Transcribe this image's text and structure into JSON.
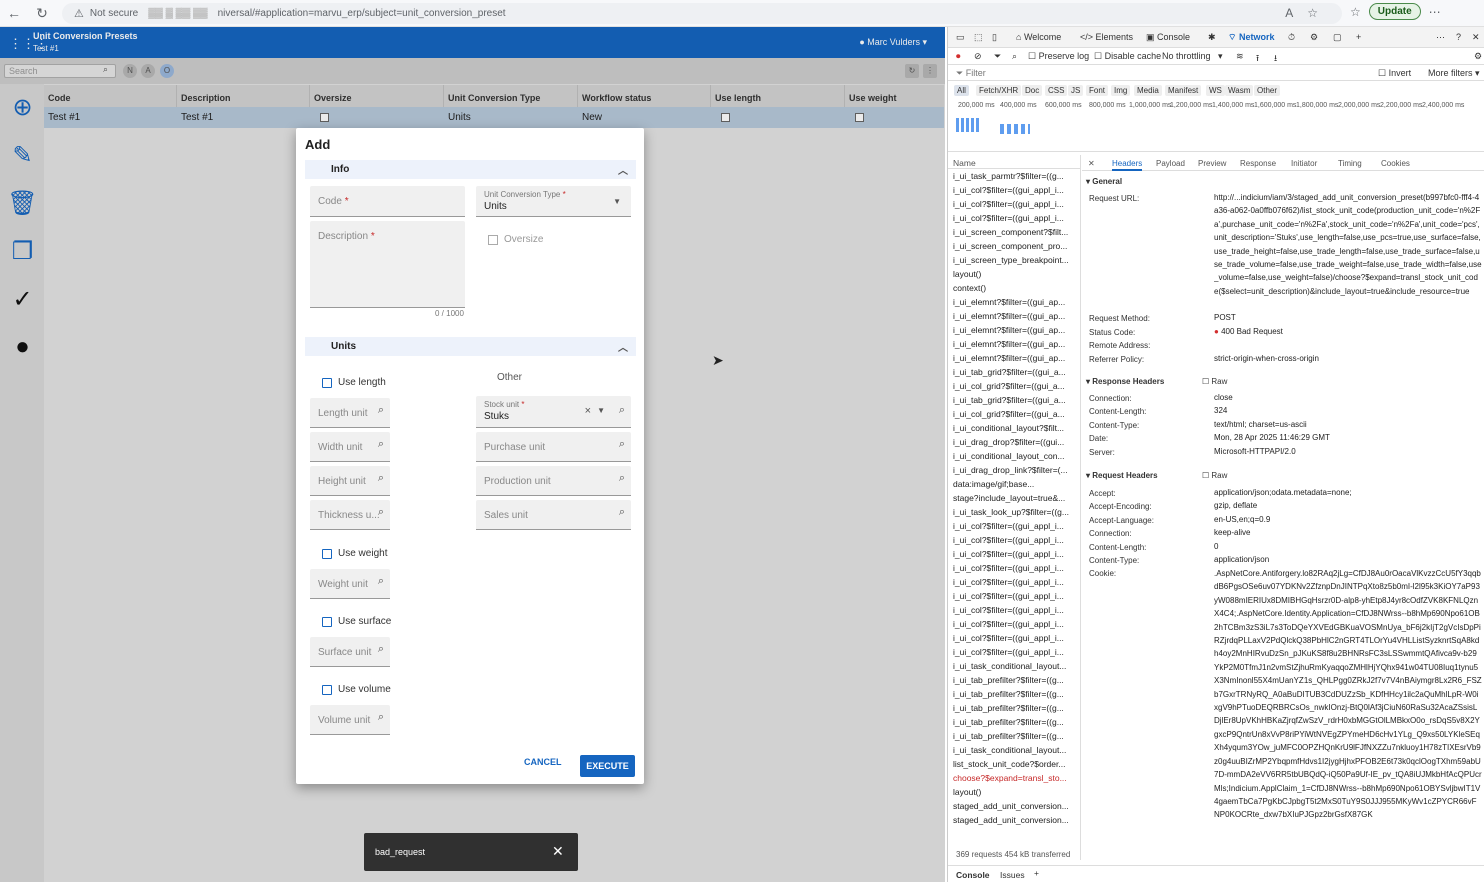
{
  "browser": {
    "security": "Not secure",
    "url": "niversal/#application=marvu_erp/subject=unit_conversion_preset",
    "update_label": "Update"
  },
  "app": {
    "title": "Unit Conversion Presets",
    "subtitle": "Test #1",
    "user": "Marc Vulders",
    "search_placeholder": "Search",
    "chips": [
      "N",
      "A",
      "O"
    ],
    "columns": [
      "Code",
      "Description",
      "Oversize",
      "Unit Conversion Type",
      "Workflow status",
      "Use length",
      "Use weight"
    ],
    "row": {
      "code": "Test #1",
      "description": "Test #1",
      "type": "Units",
      "status": "New"
    }
  },
  "dialog": {
    "title": "Add",
    "info_section": "Info",
    "code_label": "Code",
    "description_label": "Description",
    "type_label": "Unit Conversion Type",
    "type_value": "Units",
    "oversize_label": "Oversize",
    "counter": "0 / 1000",
    "units_section": "Units",
    "use_length": "Use length",
    "other_label": "Other",
    "length_unit": "Length unit",
    "width_unit": "Width unit",
    "height_unit": "Height unit",
    "thickness_unit": "Thickness u...",
    "stock_unit_label": "Stock unit",
    "stock_unit_value": "Stuks",
    "purchase_unit": "Purchase unit",
    "production_unit": "Production unit",
    "sales_unit": "Sales unit",
    "use_weight": "Use weight",
    "weight_unit": "Weight unit",
    "use_surface": "Use surface",
    "surface_unit": "Surface unit",
    "use_volume": "Use volume",
    "volume_unit": "Volume unit",
    "cancel": "CANCEL",
    "execute": "EXECUTE"
  },
  "toast": {
    "message": "bad_request"
  },
  "devtools": {
    "tabs": [
      "Welcome",
      "Elements",
      "Console",
      "Network"
    ],
    "preserve_log": "Preserve log",
    "disable_cache": "Disable cache",
    "throttling": "No throttling",
    "filter": "Filter",
    "invert": "Invert",
    "more_filters": "More filters",
    "types": [
      "All",
      "Fetch/XHR",
      "Doc",
      "CSS",
      "JS",
      "Font",
      "Img",
      "Media",
      "Manifest",
      "WS",
      "Wasm",
      "Other"
    ],
    "timeline_ticks": [
      "200,000 ms",
      "400,000 ms",
      "600,000 ms",
      "800,000 ms",
      "1,000,000 ms",
      "1,200,000 ms",
      "1,400,000 ms",
      "1,600,000 ms",
      "1,800,000 ms",
      "2,000,000 ms",
      "2,200,000 ms",
      "2,400,000 ms"
    ],
    "name_header": "Name",
    "requests": [
      "i_ui_task_parmtr?$filter=((g...",
      "i_ui_col?$filter=((gui_appl_i...",
      "i_ui_col?$filter=((gui_appl_i...",
      "i_ui_col?$filter=((gui_appl_i...",
      "i_ui_screen_component?$filt...",
      "i_ui_screen_component_pro...",
      "i_ui_screen_type_breakpoint...",
      "layout()",
      "context()",
      "i_ui_elemnt?$filter=((gui_ap...",
      "i_ui_elemnt?$filter=((gui_ap...",
      "i_ui_elemnt?$filter=((gui_ap...",
      "i_ui_elemnt?$filter=((gui_ap...",
      "i_ui_elemnt?$filter=((gui_ap...",
      "i_ui_tab_grid?$filter=((gui_a...",
      "i_ui_col_grid?$filter=((gui_a...",
      "i_ui_tab_grid?$filter=((gui_a...",
      "i_ui_col_grid?$filter=((gui_a...",
      "i_ui_conditional_layout?$filt...",
      "i_ui_drag_drop?$filter=((gui...",
      "i_ui_conditional_layout_con...",
      "i_ui_drag_drop_link?$filter=(...",
      "data:image/gif;base...",
      "stage?include_layout=true&...",
      "i_ui_task_look_up?$filter=((g...",
      "i_ui_col?$filter=((gui_appl_i...",
      "i_ui_col?$filter=((gui_appl_i...",
      "i_ui_col?$filter=((gui_appl_i...",
      "i_ui_col?$filter=((gui_appl_i...",
      "i_ui_col?$filter=((gui_appl_i...",
      "i_ui_col?$filter=((gui_appl_i...",
      "i_ui_col?$filter=((gui_appl_i...",
      "i_ui_col?$filter=((gui_appl_i...",
      "i_ui_col?$filter=((gui_appl_i...",
      "i_ui_col?$filter=((gui_appl_i...",
      "i_ui_task_conditional_layout...",
      "i_ui_tab_prefilter?$filter=((g...",
      "i_ui_tab_prefilter?$filter=((g...",
      "i_ui_tab_prefilter?$filter=((g...",
      "i_ui_tab_prefilter?$filter=((g...",
      "i_ui_tab_prefilter?$filter=((g...",
      "i_ui_task_conditional_layout...",
      "list_stock_unit_code?$order...",
      "choose?$expand=transl_sto...",
      "layout()",
      "staged_add_unit_conversion...",
      "staged_add_unit_conversion..."
    ],
    "summary": "369 requests   454 kB transferred",
    "detail_tabs": [
      "Headers",
      "Payload",
      "Preview",
      "Response",
      "Initiator",
      "Timing",
      "Cookies"
    ],
    "general": "General",
    "request_url_key": "Request URL:",
    "request_url": "http://...indicium/iam/3/staged_add_unit_conversion_preset(b997bfc0-fff4-4a36-a062-0a0ffb076f62)/list_stock_unit_code(production_unit_code='n%2Fa',purchase_unit_code='n%2Fa',stock_unit_code='n%2Fa',unit_code='pcs',unit_description='Stuks',use_length=false,use_pcs=true,use_surface=false,use_trade_height=false,use_trade_length=false,use_trade_surface=false,use_trade_volume=false,use_trade_weight=false,use_trade_width=false,use_volume=false,use_weight=false)/choose?$expand=transl_stock_unit_code($select=unit_description)&include_layout=true&include_resource=true",
    "method_key": "Request Method:",
    "method": "POST",
    "status_key": "Status Code:",
    "status": "400 Bad Request",
    "remote_key": "Remote Address:",
    "referrer_key": "Referrer Policy:",
    "referrer": "strict-origin-when-cross-origin",
    "response_headers": "Response Headers",
    "raw": "Raw",
    "resp": [
      [
        "Connection:",
        "close"
      ],
      [
        "Content-Length:",
        "324"
      ],
      [
        "Content-Type:",
        "text/html; charset=us-ascii"
      ],
      [
        "Date:",
        "Mon, 28 Apr 2025 11:46:29 GMT"
      ],
      [
        "Server:",
        "Microsoft-HTTPAPI/2.0"
      ]
    ],
    "request_headers": "Request Headers",
    "req": [
      [
        "Accept:",
        "application/json;odata.metadata=none;"
      ],
      [
        "Accept-Encoding:",
        "gzip, deflate"
      ],
      [
        "Accept-Language:",
        "en-US,en;q=0.9"
      ],
      [
        "Connection:",
        "keep-alive"
      ],
      [
        "Content-Length:",
        "0"
      ],
      [
        "Content-Type:",
        "application/json"
      ],
      [
        "Cookie:",
        ""
      ]
    ],
    "cookie": ".AspNetCore.Antiforgery.lo82RAq2jLg=CfDJ8Au0rOacaVlKvzzCcU5fY3qqbdB6PgsOSe6uv07YDKNv2ZfznpDnJINTPqXto8z5b0mI-l2l95k3KiOY7aP93yW088mIERIUx8DMIBHGqHsrzr0D-alp8-yhEtp8J4yr8cOdfZVK8KFNLQznX4C4;.AspNetCore.Identity.Application=CfDJ8NWrss--b8hMp690Npo61OB2hTCBm3zS3iL7s3ToDQeYXVEdGBKuaVOSMnUya_bF6j2kIjT2gVcIsDpPiRZjrdqPLLaxV2PdQlckQ38PbHlC2nGRT4TLOrYu4VHLListSyzknrtSqA8kdh4oy2MnHIRvuDzSn_pJKuKS8f8u2BHNRsFC3sLSSwmmtQAfivca9v-b29YkP2M0TfmJ1n2vmStZjhuRmKyaqqoZMHlHjYQhx941w04TU08Iuq1tynu5X3NmInonl55X4mUanYZ1s_QHLPgg0ZRkJ2f7v7V4nBAiymgr8Lx2R6_FSZb7GxrTRNyRQ_A0aBuDITUB3CdDUZzSb_KDfHHcy1ilc2aQuMhlLpR-W0ixgV9hPTuoDEQRBRCsOs_nwkIOnzj-BtQ0lAf3jCiuN60RaSu32AcaZSsisLDjlEr8UpVKhHBKaZjrqfZwSzV_rdrH0xbMGGtOlLMBkxO0o_rsDqS5v8X2YgxcP9QntrUn8xVvP8riPYiWtNVEgZPYmeHD6cHv1YLg_Q9xs50LYKleSEqXh4yqum3YOw_juMFC0OPZHQnKrU9lFJfNXZZu7nkluoy1H78zTIXEsrVb9z0g4uuBIZrMP2YbqpmfHdvs1I2jygHjhxPFOB2E6t73k0qclOogTXhm59abU7D-mmDA2eVV6RR5tbUBQdQ-iQ50Pa9Uf-IE_pv_tQA8iUJMkbHfAcQPUcrMls;Indicium.ApplClaim_1=CfDJ8NWrss--b8hMp690Npo61OBYSvljbwIT1V4gaemTbCa7PgKbCJpbgT5t2MxS0TuY9S0JJJ955MKyWv1cZPYCR66vFNP0KOCRte_dxw7bXIuPJGpz2brGsfX87GK",
    "bottom_tabs": [
      "Console",
      "Issues"
    ]
  }
}
